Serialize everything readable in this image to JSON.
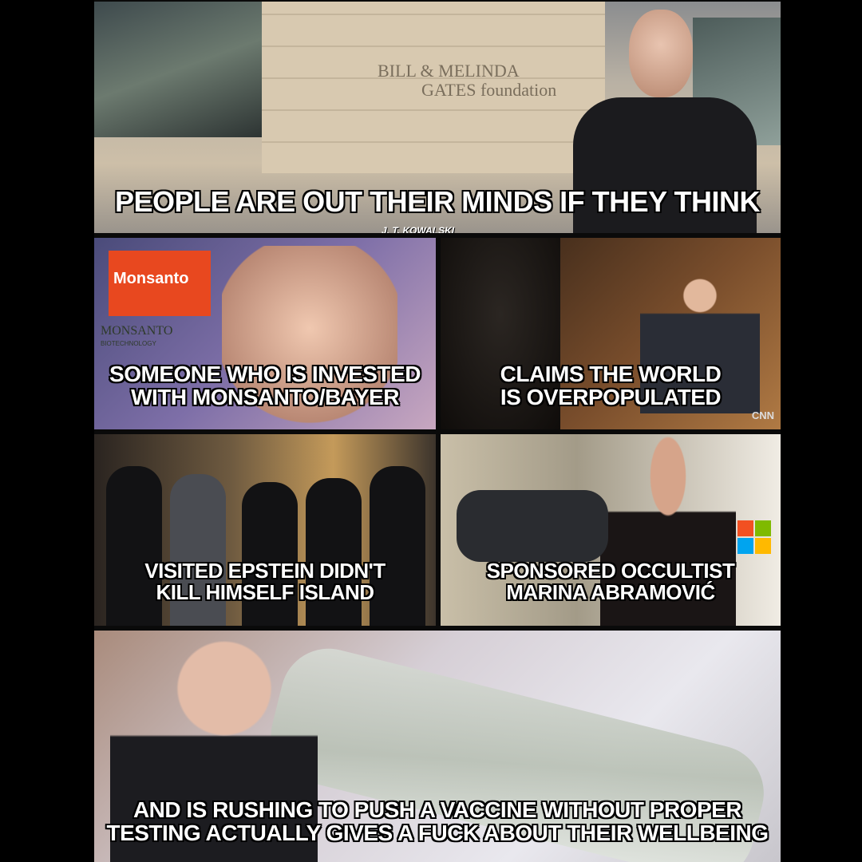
{
  "panel1": {
    "building_sign_line1": "BILL & MELINDA",
    "building_sign_line2": "GATES foundation",
    "caption": "PEOPLE ARE OUT THEIR MINDS IF THEY THINK",
    "credit": "J. T. KOWALSKI"
  },
  "panel2": {
    "logo_text": "Monsanto",
    "logo_sub": "MONSANTO",
    "logo_sub2": "BIOTECHNOLOGY",
    "caption_line1": "SOMEONE WHO IS INVESTED",
    "caption_line2": "WITH MONSANTO/BAYER"
  },
  "panel3": {
    "caption_line1": "CLAIMS THE WORLD",
    "caption_line2": "IS OVERPOPULATED",
    "watermark": "CNN"
  },
  "panel4": {
    "caption_line1": "VISITED EPSTEIN DIDN'T",
    "caption_line2": "KILL HIMSELF ISLAND"
  },
  "panel5": {
    "caption_line1": "SPONSORED OCCULTIST",
    "caption_line2": "MARINA ABRAMOVIĆ",
    "logo_colors": [
      "#f25022",
      "#7fba00",
      "#00a4ef",
      "#ffb900"
    ]
  },
  "panel6": {
    "caption_line1": "AND IS RUSHING TO PUSH A VACCINE WITHOUT PROPER",
    "caption_line2": "TESTING ACTUALLY GIVES A FUCK ABOUT THEIR WELLBEING"
  }
}
